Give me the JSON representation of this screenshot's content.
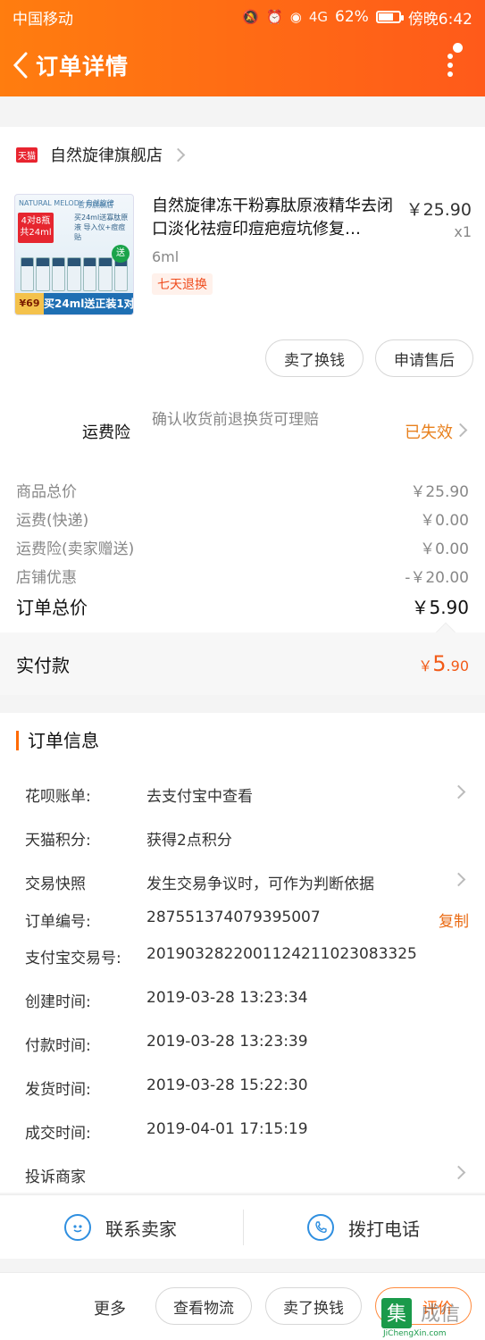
{
  "status": {
    "carrier": "中国移动",
    "battery": "62%",
    "time": "傍晚6:42",
    "signal": "4G"
  },
  "nav": {
    "title": "订单详情"
  },
  "shop": {
    "badge": "天猫",
    "name": "自然旋律旗舰店"
  },
  "product": {
    "title": "自然旋律冻干粉寡肽原液精华去闭口淡化祛痘印痘疤痘坑修复…",
    "price": "￥25.90",
    "qty": "x1",
    "spec": "6ml",
    "badge": "七天退换",
    "image": {
      "brand": "NATURAL MELODY 自然旋律",
      "shop_tag": "官方旗舰店",
      "promo": "4对8瓶",
      "promo_sub": "共24ml",
      "desc": "买24ml送寡肽原液 导入仪+痘痘贴",
      "gift": "送",
      "price": "¥69",
      "banner": "买24ml送正装1对"
    }
  },
  "actions": {
    "sell_label": "卖了换钱",
    "aftersale_label": "申请售后"
  },
  "insurance": {
    "label": "运费险",
    "desc": "确认收货前退换货可理赔",
    "status": "已失效"
  },
  "fees": [
    {
      "label": "商品总价",
      "value": "￥25.90"
    },
    {
      "label": "运费(快递)",
      "value": "￥0.00"
    },
    {
      "label": "运费险(卖家赠送)",
      "value": "￥0.00"
    },
    {
      "label": "店铺优惠",
      "value": "-￥20.00"
    }
  ],
  "total": {
    "label": "订单总价",
    "value": "￥5.90"
  },
  "paid": {
    "label": "实付款",
    "currency": "￥",
    "int": "5",
    "dec": ".90"
  },
  "order_info": {
    "title": "订单信息",
    "rows": [
      {
        "label": "花呗账单:",
        "value": "去支付宝中查看"
      },
      {
        "label": "天猫积分:",
        "value": "获得2点积分"
      },
      {
        "label": "交易快照",
        "value": "发生交易争议时，可作为判断依据"
      },
      {
        "label": "订单编号:",
        "value": "287551374079395007"
      },
      {
        "label": "支付宝交易号:",
        "value": "2019032822001124211023083325"
      },
      {
        "label": "创建时间:",
        "value": "2019-03-28 13:23:34"
      },
      {
        "label": "付款时间:",
        "value": "2019-03-28 13:23:39"
      },
      {
        "label": "发货时间:",
        "value": "2019-03-28 15:22:30"
      },
      {
        "label": "成交时间:",
        "value": "2019-04-01 17:15:19"
      },
      {
        "label": "投诉商家",
        "value": ""
      }
    ],
    "copy_label": "复制"
  },
  "contact": {
    "seller_label": "联系卖家",
    "phone_label": "拨打电话"
  },
  "bottom": {
    "more_label": "更多",
    "logistics_label": "查看物流",
    "sell_label": "卖了换钱",
    "review_label": "评价"
  },
  "watermark": {
    "text": "JiChengXin.com"
  },
  "colors": {
    "accent": "#ff6a12",
    "orange_text": "#e8801d",
    "price_red": "#f25b18",
    "link_blue": "#2f8fe0"
  }
}
